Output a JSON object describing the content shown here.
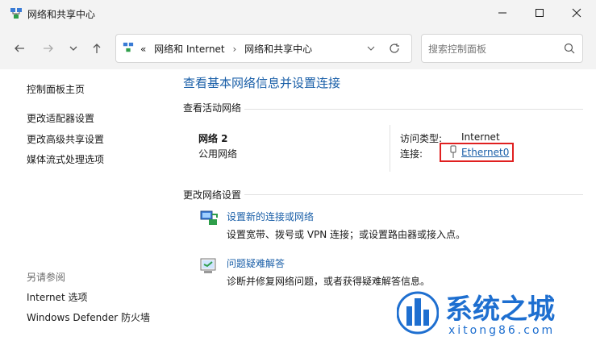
{
  "window": {
    "title": "网络和共享中心",
    "minimize_icon": "minimize-icon",
    "maximize_icon": "maximize-icon",
    "close_icon": "close-icon"
  },
  "toolbar": {
    "address_prefix": "«",
    "breadcrumb": [
      "网络和 Internet",
      "网络和共享中心"
    ],
    "search_placeholder": "搜索控制面板"
  },
  "sidebar": {
    "home": "控制面板主页",
    "links": [
      "更改适配器设置",
      "更改高级共享设置",
      "媒体流式处理选项"
    ],
    "see_also_title": "另请参阅",
    "see_also": [
      "Internet 选项",
      "Windows Defender 防火墙"
    ]
  },
  "main": {
    "title": "查看基本网络信息并设置连接",
    "active_networks_title": "查看活动网络",
    "network": {
      "name": "网络 2",
      "type": "公用网络",
      "access_type_label": "访问类型:",
      "access_type_value": "Internet",
      "connections_label": "连接:",
      "connection_name": "Ethernet0"
    },
    "change_settings_title": "更改网络设置",
    "tasks": [
      {
        "title": "设置新的连接或网络",
        "desc": "设置宽带、拨号或 VPN 连接；或设置路由器或接入点。",
        "icon": "new-connection-icon"
      },
      {
        "title": "问题疑难解答",
        "desc": "诊断并修复网络问题，或者获得疑难解答信息。",
        "icon": "troubleshoot-icon"
      }
    ]
  },
  "watermark": {
    "brand": "系统之城",
    "url": "xitong86.com"
  },
  "colors": {
    "link": "#1a5fa8",
    "highlight_border": "#e02020",
    "chrome": "#f3f3f3"
  }
}
